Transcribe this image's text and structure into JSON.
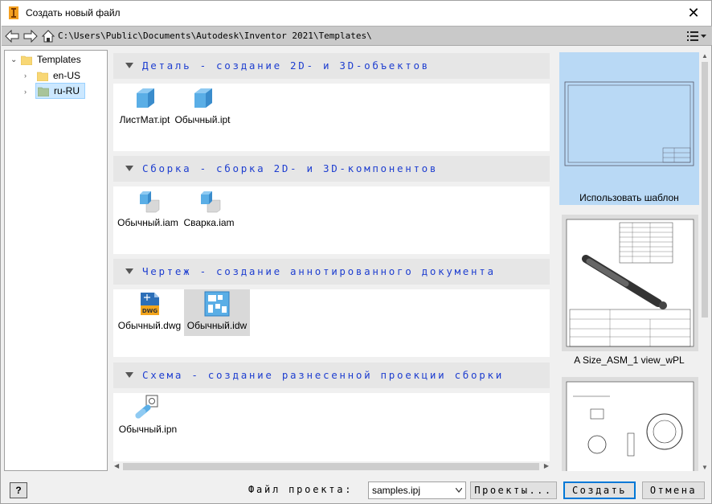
{
  "window": {
    "title": "Создать новый файл",
    "close_glyph": "✕"
  },
  "pathbar": {
    "path": "C:\\Users\\Public\\Documents\\Autodesk\\Inventor 2021\\Templates\\"
  },
  "tree": {
    "items": [
      {
        "label": "Templates",
        "icon": "folder-icon",
        "expanded": true
      },
      {
        "label": "en-US",
        "icon": "folder-icon"
      },
      {
        "label": "ru-RU",
        "icon": "folder-icon",
        "selected": true
      }
    ]
  },
  "sections": [
    {
      "title": "Деталь - создание 2D- и 3D-объектов",
      "files": [
        {
          "name": "ЛистМат.ipt",
          "icon": "part-cube-icon"
        },
        {
          "name": "Обычный.ipt",
          "icon": "part-cube-icon"
        }
      ]
    },
    {
      "title": "Сборка - сборка 2D- и 3D-компонентов",
      "files": [
        {
          "name": "Обычный.iam",
          "icon": "assembly-icon"
        },
        {
          "name": "Сварка.iam",
          "icon": "assembly-icon"
        }
      ]
    },
    {
      "title": "Чертеж - создание аннотированного документа",
      "files": [
        {
          "name": "Обычный.dwg",
          "icon": "dwg-drawing-icon",
          "badge": "DWG"
        },
        {
          "name": "Обычный.idw",
          "icon": "idw-drawing-icon",
          "selected": true
        }
      ]
    },
    {
      "title": "Схема - создание разнесенной проекции сборки",
      "files": [
        {
          "name": "Обычный.ipn",
          "icon": "presentation-icon"
        }
      ]
    }
  ],
  "preview": {
    "items": [
      {
        "label": "Использовать шаблон",
        "selected": true
      },
      {
        "label": "A Size_ASM_1 view_wPL"
      },
      {
        "label": ""
      }
    ]
  },
  "footer": {
    "help_label": "?",
    "project_label": "Файл проекта:",
    "project_value": "samples.ipj",
    "projects_button": "Проекты...",
    "create_button": "Создать",
    "cancel_button": "Отмена"
  },
  "colors": {
    "section_title": "#1f3fd0",
    "selection": "#cce8ff",
    "preview_selected": "#b9d9f5",
    "part_blue": "#5aaee6"
  }
}
